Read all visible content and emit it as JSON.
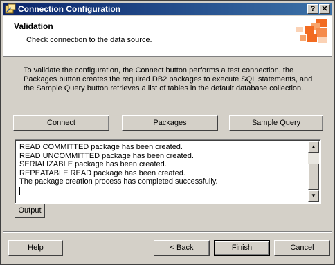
{
  "window": {
    "title": "Connection Configuration",
    "help_btn": "?",
    "close_btn": "✕"
  },
  "header": {
    "title": "Validation",
    "subtitle": "Check connection to the data source."
  },
  "description": "To validate the configuration, the Connect button performs a test connection, the Packages button creates the required DB2 packages to execute SQL statements, and the Sample Query button retrieves a list of tables in the default database collection.",
  "actions": {
    "connect": {
      "pre": "",
      "key": "C",
      "post": "onnect"
    },
    "packages": {
      "pre": "",
      "key": "P",
      "post": "ackages"
    },
    "sample_query": {
      "pre": "",
      "key": "S",
      "post": "ample Query"
    }
  },
  "output": {
    "lines": [
      "READ COMMITTED package has been created.",
      "READ UNCOMMITTED package has been created.",
      "SERIALIZABLE package has been created.",
      "REPEATABLE READ package has been created.",
      "The package creation process has completed successfully."
    ],
    "tab_label": "Output",
    "scroll_up": "▲",
    "scroll_down": "▼"
  },
  "footer": {
    "help": {
      "pre": "",
      "key": "H",
      "post": "elp"
    },
    "back": {
      "pre": "< ",
      "key": "B",
      "post": "ack"
    },
    "finish": "Finish",
    "cancel": "Cancel"
  },
  "colors": {
    "title_bar": "#0a246a",
    "face": "#d4d0c8",
    "logo_orange": "#f26b21"
  }
}
